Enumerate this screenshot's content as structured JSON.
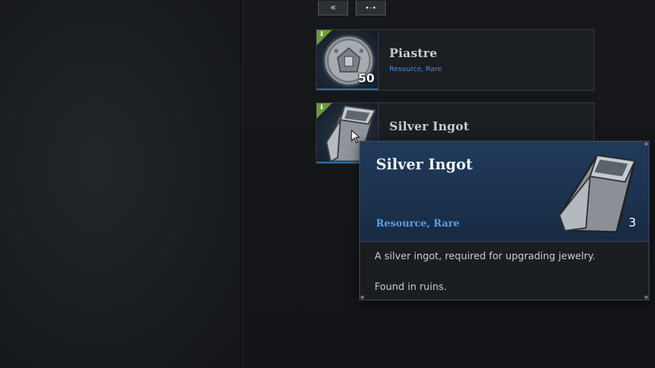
{
  "toolbar": {
    "back_button_icon": "double-chevron-left-icon",
    "back_button_glyph": "«",
    "options_button_icon": "dots-icon",
    "options_button_glyph": "•·•"
  },
  "inventory": {
    "items": [
      {
        "name": "Piastre",
        "tags": "Resource, Rare",
        "quantity": "50",
        "icon": "coin-icon",
        "badge_icon": "download-icon"
      },
      {
        "name": "Silver Ingot",
        "tags": "",
        "quantity": "",
        "icon": "silver-ingot-icon",
        "badge_icon": "download-icon"
      }
    ]
  },
  "tooltip": {
    "title": "Silver Ingot",
    "tags": "Resource, Rare",
    "quantity": "3",
    "description": "A silver ingot, required for upgrading jewelry.",
    "source": "Found in ruins.",
    "icon": "silver-ingot-icon"
  },
  "colors": {
    "badge_green": "#6a9a3a",
    "tag_blue": "#4f8fd0",
    "header_blue": "#203a5a"
  }
}
